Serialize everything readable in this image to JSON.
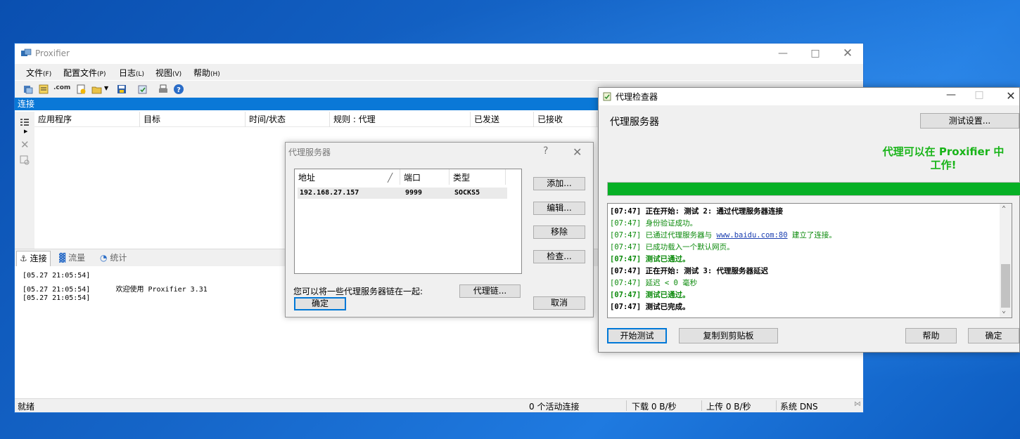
{
  "main": {
    "title": "Proxifier",
    "menu": [
      {
        "label": "文件",
        "acc": "(F)"
      },
      {
        "label": "配置文件",
        "acc": "(P)"
      },
      {
        "label": "日志",
        "acc": "(L)"
      },
      {
        "label": "视图",
        "acc": "(V)"
      },
      {
        "label": "帮助",
        "acc": "(H)"
      }
    ],
    "toolbar_com": ".com",
    "section": "连接",
    "columns": [
      "应用程序",
      "目标",
      "时间/状态",
      "规则 : 代理",
      "已发送",
      "已接收"
    ],
    "tabs": [
      "连接",
      "流量",
      "统计"
    ],
    "log": [
      {
        "time": "[05.27 21:05:54]",
        "msg": ""
      },
      {
        "time": "[05.27 21:05:54]",
        "msg": "欢迎使用 Proxifier 3.31"
      },
      {
        "time": "[05.27 21:05:54]",
        "msg": ""
      }
    ],
    "status": {
      "ready": "就绪",
      "active": "0 个活动连接",
      "down": "下载 0 B/秒",
      "up": "上传 0 B/秒",
      "dns": "系统 DNS"
    }
  },
  "proxy_dialog": {
    "title": "代理服务器",
    "help": "?",
    "columns": [
      "地址",
      "端口",
      "类型"
    ],
    "sort_mark": "╱",
    "row": {
      "address": "192.168.27.157",
      "port": "9999",
      "type": "SOCKS5"
    },
    "buttons": {
      "add": "添加...",
      "edit": "编辑...",
      "remove": "移除",
      "check": "检查...",
      "cancel": "取消",
      "ok": "确定",
      "chain": "代理链..."
    },
    "note": "您可以将一些代理服务器链在一起:"
  },
  "checker": {
    "title": "代理检查器",
    "heading": "代理服务器",
    "settings_btn": "测试设置...",
    "result_line1": "代理可以在 Proxifier 中",
    "result_line2": "工作!",
    "progress": 1.0,
    "log": [
      {
        "text": "[07:47] 正在开始: 测试 2: 通过代理服务器连接",
        "style": "bold"
      },
      {
        "text": "[07:47] 身份验证成功。",
        "style": "green"
      },
      {
        "pre": "[07:47] 已通过代理服务器与 ",
        "link": "www.baidu.com:80",
        "post": " 建立了连接。",
        "style": "green"
      },
      {
        "text": "[07:47] 已成功载入一个默认网页。",
        "style": "green"
      },
      {
        "text": "[07:47] 测试已通过。",
        "style": "bold green"
      },
      {
        "text": "[07:47] 正在开始: 测试 3: 代理服务器延迟",
        "style": "bold"
      },
      {
        "text": "[07:47] 延迟 < 0 毫秒",
        "style": "green"
      },
      {
        "text": "[07:47] 测试已通过。",
        "style": "bold green"
      },
      {
        "text": "[07:47] 测试已完成。",
        "style": "bold"
      }
    ],
    "buttons": {
      "start": "开始测试",
      "copy": "复制到剪贴板",
      "help": "帮助",
      "ok": "确定"
    }
  },
  "colors": {
    "accent": "#0a78d7",
    "success": "#06b025",
    "success_text": "#18b418"
  }
}
